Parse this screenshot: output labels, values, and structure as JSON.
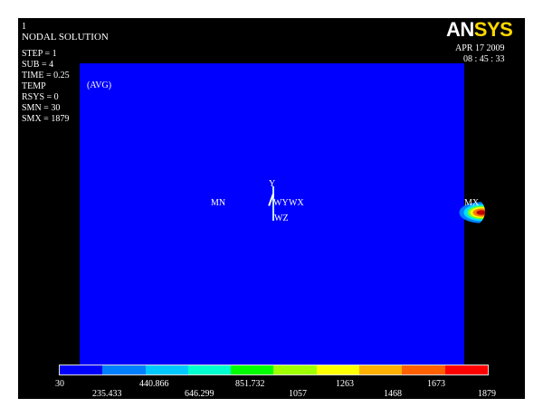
{
  "header": {
    "window_number": "1",
    "title": "NODAL SOLUTION",
    "info_lines": [
      "STEP = 1",
      "SUB = 4",
      "TIME = 0.25",
      "TEMP",
      "RSYS = 0",
      "SMN = 30",
      "SMX = 1879"
    ]
  },
  "logo": {
    "part1": "AN",
    "part2": "SYS",
    "color_part1": "#ffffff",
    "color_part2": "#ffd800"
  },
  "datetime": {
    "date": "APR 17 2009",
    "time": "08 : 45 : 33"
  },
  "plot": {
    "avg_label": "(AVG)",
    "min_label": "MN",
    "max_label": "MX",
    "axis_y": "Y",
    "axis_wy": "WY",
    "axis_wx": "WX",
    "axis_wz": "WZ",
    "background_color": "#0000ff"
  },
  "legend": {
    "colors": [
      "#0000ff",
      "#0080ff",
      "#00c8ff",
      "#00ffd0",
      "#00ff00",
      "#a0ff00",
      "#ffff00",
      "#ffb000",
      "#ff6000",
      "#ff0000"
    ],
    "upper_ticks": [
      "30",
      "440.866",
      "851.732",
      "1263",
      "1673"
    ],
    "lower_ticks": [
      "235.433",
      "646.299",
      "1057",
      "1468",
      "1879"
    ]
  }
}
